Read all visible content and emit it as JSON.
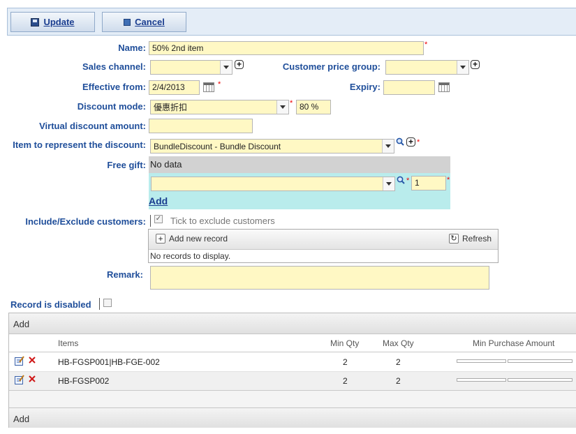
{
  "toolbar": {
    "update_label": "Update",
    "cancel_label": "Cancel"
  },
  "form": {
    "name_label": "Name:",
    "name_value": "50% 2nd item",
    "sales_channel_label": "Sales channel:",
    "sales_channel_value": "",
    "customer_price_group_label": "Customer price group:",
    "customer_price_group_value": "",
    "effective_from_label": "Effective from:",
    "effective_from_value": "2/4/2013",
    "expiry_label": "Expiry:",
    "expiry_value": "",
    "discount_mode_label": "Discount mode:",
    "discount_mode_value": "優惠折扣",
    "discount_percent": "80 %",
    "virtual_discount_label": "Virtual discount amount:",
    "virtual_discount_value": "",
    "item_represent_label": "Item to represent the discount:",
    "item_represent_value": "BundleDiscount - Bundle Discount",
    "free_gift_label": "Free gift:",
    "free_gift_no_data": "No data",
    "free_gift_qty": "1",
    "free_gift_add": "Add",
    "include_exclude_label": "Include/Exclude customers:",
    "exclude_checkbox_label": "Tick to exclude customers",
    "add_new_record_label": "Add new record",
    "refresh_label": "Refresh",
    "no_records_text": "No records to display.",
    "remark_label": "Remark:",
    "remark_value": "",
    "record_disabled_label": "Record is disabled"
  },
  "grid": {
    "add_top": "Add",
    "add_bottom": "Add",
    "columns": [
      "Items",
      "Min Qty",
      "Max Qty",
      "Min Purchase Amount"
    ],
    "rows": [
      {
        "items": "HB-FGSP001|HB-FGE-002",
        "min_qty": "2",
        "max_qty": "2"
      },
      {
        "items": "HB-FGSP002",
        "min_qty": "2",
        "max_qty": "2"
      }
    ]
  },
  "colors": {
    "label_blue": "#1f4e9a",
    "field_yellow": "#fff8c4",
    "gift_panel": "#b9ecec",
    "required_red": "#ee0000"
  }
}
